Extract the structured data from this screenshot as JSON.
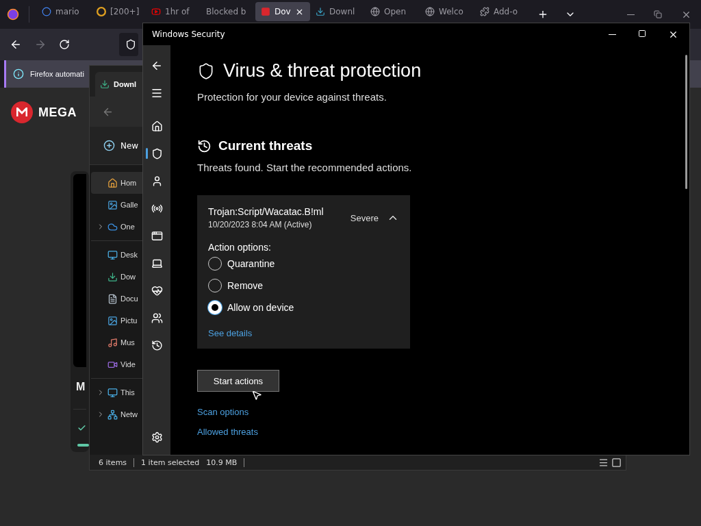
{
  "browser": {
    "tabs": [
      {
        "label": "mario",
        "selected": false
      },
      {
        "label": "[200+]",
        "selected": false
      },
      {
        "label": "1hr of",
        "selected": false
      },
      {
        "label": "Blocked b",
        "selected": false
      },
      {
        "label": "Dov",
        "selected": true
      },
      {
        "label": "Downl",
        "selected": false
      },
      {
        "label": "Open",
        "selected": false
      },
      {
        "label": "Welco",
        "selected": false
      },
      {
        "label": "Add-o",
        "selected": false
      }
    ],
    "notification": "Firefox automati",
    "page": {
      "logo": "MEGA",
      "card_title": "M",
      "card_progress": {
        "level": 1
      }
    }
  },
  "explorer": {
    "tab": "Downl",
    "new_button": "New",
    "nav_groups": [
      [
        {
          "label": "Hom",
          "selected": true,
          "expandable": false
        },
        {
          "label": "Galle",
          "selected": false,
          "expandable": false
        },
        {
          "label": "One",
          "selected": false,
          "expandable": true
        }
      ],
      [
        {
          "label": "Desk",
          "selected": false,
          "expandable": false
        },
        {
          "label": "Dow",
          "selected": false,
          "expandable": false
        },
        {
          "label": "Docu",
          "selected": false,
          "expandable": false
        },
        {
          "label": "Pictu",
          "selected": false,
          "expandable": false
        },
        {
          "label": "Mus",
          "selected": false,
          "expandable": false
        },
        {
          "label": "Vide",
          "selected": false,
          "expandable": false
        }
      ],
      [
        {
          "label": "This",
          "selected": false,
          "expandable": true
        },
        {
          "label": "Netw",
          "selected": false,
          "expandable": true
        }
      ]
    ],
    "status_bar": {
      "items": "6 items",
      "selection": "1 item selected",
      "size": "10.9 MB"
    }
  },
  "security": {
    "window_title": "Windows Security",
    "nav_items": [
      {
        "selected": false
      },
      {
        "selected": true
      },
      {
        "selected": false
      },
      {
        "selected": false
      },
      {
        "selected": false
      },
      {
        "selected": false
      },
      {
        "selected": false
      },
      {
        "selected": false
      },
      {
        "selected": false
      }
    ],
    "heading": "Virus & threat protection",
    "subtitle": "Protection for your device against threats.",
    "section_title": "Current threats",
    "section_text": "Threats found. Start the recommended actions.",
    "threat": {
      "name": "Trojan:Script/Wacatac.B!ml",
      "date": "10/20/2023 8:04 AM (Active)",
      "severity": "Severe",
      "expanded": true,
      "action_label": "Action options:",
      "options": [
        {
          "label": "Quarantine",
          "selected": false
        },
        {
          "label": "Remove",
          "selected": false
        },
        {
          "label": "Allow on device",
          "selected": true
        }
      ],
      "details_link": "See details"
    },
    "start_button": "Start actions",
    "links": [
      "Scan options",
      "Allowed threats"
    ]
  }
}
